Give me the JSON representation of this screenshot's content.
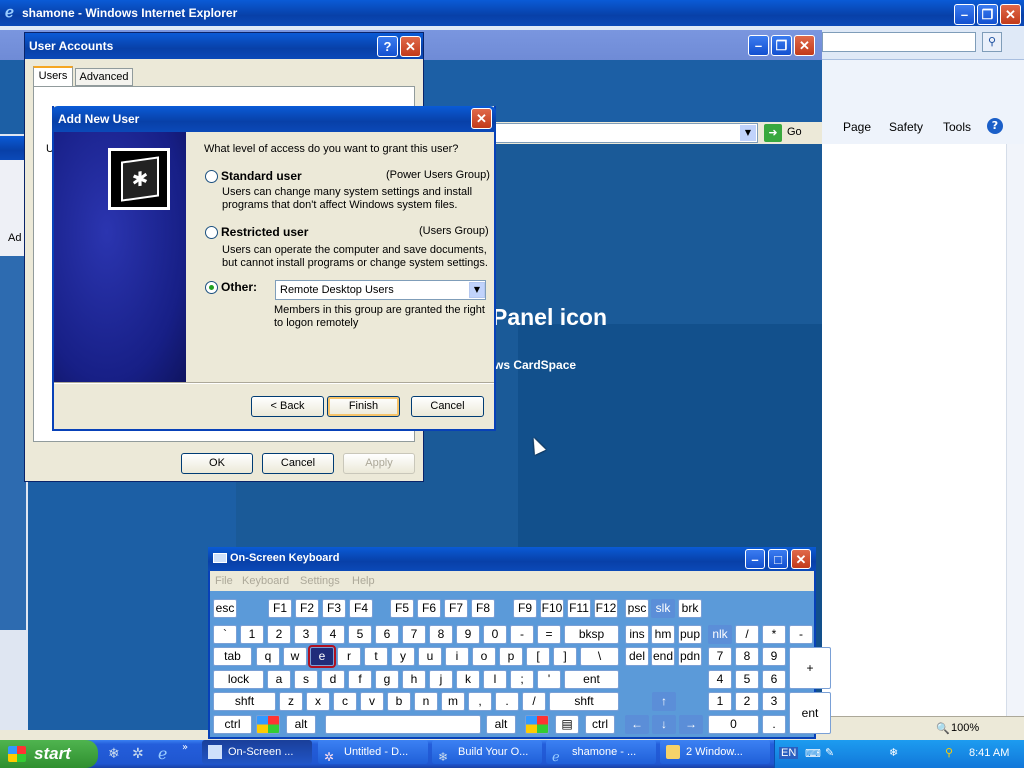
{
  "ie": {
    "title": "shamone - Windows Internet Explorer",
    "go_label": "Go",
    "toolbar": [
      "Page",
      "Safety",
      "Tools"
    ],
    "zoom": "100%"
  },
  "control_panel": {
    "heading": "Panel icon",
    "link": "ws CardSpace"
  },
  "user_accounts": {
    "title": "User Accounts",
    "tabs": [
      "Users",
      "Advanced"
    ],
    "left_fragments": [
      "U",
      "Ad"
    ],
    "ok": "OK",
    "cancel": "Cancel",
    "apply": "Apply"
  },
  "add_user": {
    "title": "Add New User",
    "question": "What level of access do you want to grant this user?",
    "standard_label": "Standard user",
    "standard_group": "(Power Users Group)",
    "standard_desc1": "Users can change many system settings and install",
    "standard_desc2": "programs that don't affect Windows system files.",
    "restricted_label": "Restricted user",
    "restricted_group": "(Users Group)",
    "restricted_desc1": "Users can operate the computer and save documents,",
    "restricted_desc2": "but cannot install programs or change system settings.",
    "other_label": "Other:",
    "other_value": "Remote Desktop Users",
    "other_desc1": "Members in this group are granted the right",
    "other_desc2": "to logon remotely",
    "back": "< Back",
    "finish": "Finish",
    "cancel": "Cancel",
    "selected": "other"
  },
  "osk": {
    "title": "On-Screen Keyboard",
    "menu": [
      "File",
      "Keyboard",
      "Settings",
      "Help"
    ],
    "rows": [
      [
        "esc",
        "F1",
        "F2",
        "F3",
        "F4",
        "F5",
        "F6",
        "F7",
        "F8",
        "F9",
        "F10",
        "F11",
        "F12",
        "psc",
        "slk",
        "brk"
      ],
      [
        "`",
        "1",
        "2",
        "3",
        "4",
        "5",
        "6",
        "7",
        "8",
        "9",
        "0",
        "-",
        "=",
        "bksp",
        "ins",
        "hm",
        "pup",
        "nlk",
        "/",
        "*",
        "-"
      ],
      [
        "tab",
        "q",
        "w",
        "e",
        "r",
        "t",
        "y",
        "u",
        "i",
        "o",
        "p",
        "[",
        "]",
        "\\",
        "del",
        "end",
        "pdn",
        "7",
        "8",
        "9",
        "+"
      ],
      [
        "lock",
        "a",
        "s",
        "d",
        "f",
        "g",
        "h",
        "j",
        "k",
        "l",
        ";",
        "'",
        "ent",
        "4",
        "5",
        "6"
      ],
      [
        "shft",
        "z",
        "x",
        "c",
        "v",
        "b",
        "n",
        "m",
        ",",
        ".",
        "/",
        "shft",
        "1",
        "2",
        "3",
        "ent"
      ],
      [
        "ctrl",
        "alt",
        "alt",
        "ctrl",
        "0",
        "."
      ]
    ],
    "selected_key": "e"
  },
  "taskbar": {
    "start": "start",
    "items": [
      "On-Screen ...",
      "Untitled - D...",
      "Build Your O...",
      "shamone - ...",
      "2 Window..."
    ],
    "lang": "EN",
    "time": "8:41 AM"
  }
}
